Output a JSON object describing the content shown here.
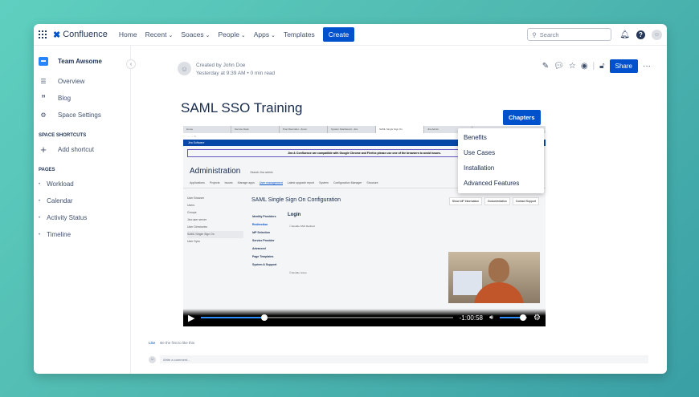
{
  "header": {
    "app_name": "Confluence",
    "nav": [
      "Home",
      "Recent",
      "Soaces",
      "People",
      "Apps",
      "Templates"
    ],
    "create_label": "Create",
    "search_placeholder": "Search"
  },
  "sidebar": {
    "space_name": "Team Awsome",
    "items": [
      {
        "label": "Overview",
        "icon": "overview-icon"
      },
      {
        "label": "Blog",
        "icon": "quote-icon"
      },
      {
        "label": "Space Settings",
        "icon": "gear-icon"
      }
    ],
    "shortcuts_title": "SPACE SHORTCUTS",
    "add_shortcut": "Add shortcut",
    "pages_title": "PAGES",
    "pages": [
      "Workload",
      "Calendar",
      "Activity Status",
      "Timeline"
    ]
  },
  "page": {
    "created_by": "Created by John Doe",
    "timestamp": "Yesterday at 9:39 AM",
    "read_time": "0 min read",
    "share_label": "Share",
    "title": "SAML SSO Training",
    "chapters_label": "Chapters",
    "chapters": [
      "Benefits",
      "Use Cases",
      "Installation",
      "Advanced Features"
    ],
    "like_label": "Like",
    "like_text": "Be the first to like this",
    "comment_placeholder": "Write a comment..."
  },
  "video": {
    "time_remaining": "-1:00:58",
    "progress": 0.25,
    "volume": 0.85,
    "browser_tabs": [
      "Home",
      "Service Desk",
      "Post Reminder - Zoom",
      "System Dashboard - Jira",
      "SAML Single Sign On",
      "Jira Admin"
    ],
    "banner": "Jira & Confluence are compatible with Google Chrome and Firefox please use one of the browsers to avoid issues.",
    "admin_title": "Administration",
    "admin_search": "Search Jira admin",
    "admin_tabs": [
      "Applications",
      "Projects",
      "Issues",
      "Manage apps",
      "User management",
      "Latest upgrade report",
      "System",
      "Configuration Manager",
      "Structure"
    ],
    "left_items": [
      "User Browser",
      "Users",
      "Groups",
      "Jira user server",
      "User Directories",
      "SAML Single Sign On",
      "User Sync"
    ],
    "config_title": "SAML Single Sign On Configuration",
    "config_buttons": [
      "Show IdP Information",
      "Documentation",
      "Contact Support"
    ],
    "config_nav": [
      "Identity Providers",
      "Redirection",
      "IdP Selection",
      "Service Provider",
      "Advanced",
      "Page Templates",
      "System & Support"
    ],
    "login_title": "Login",
    "enable_redirect": "Enable SSO Redirect",
    "enable_nosso": "Enable nosso"
  }
}
